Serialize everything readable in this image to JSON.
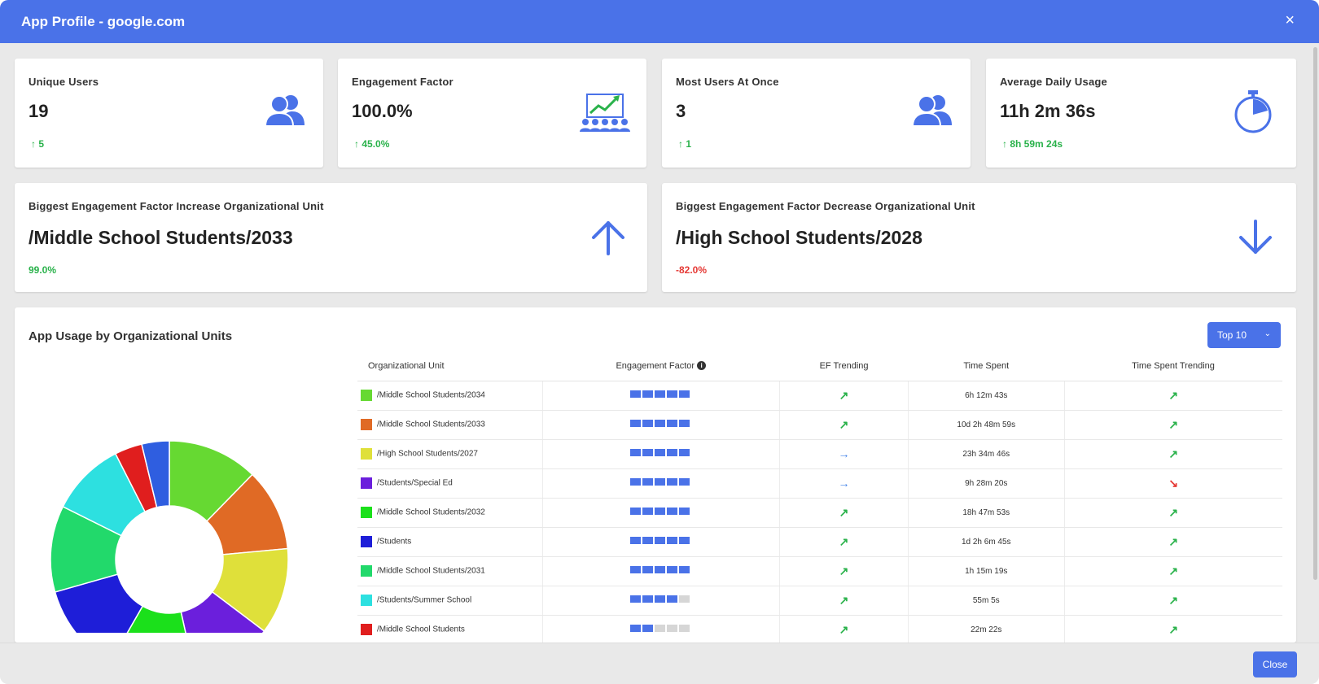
{
  "window": {
    "title": "App Profile - google.com",
    "close_glyph": "×"
  },
  "stats": [
    {
      "label": "Unique Users",
      "value": "19",
      "delta": "5",
      "icon": "users-icon"
    },
    {
      "label": "Engagement Factor",
      "value": "100.0%",
      "delta": "45.0%",
      "icon": "presentation-chart-icon"
    },
    {
      "label": "Most Users At Once",
      "value": "3",
      "delta": "1",
      "icon": "users-icon"
    },
    {
      "label": "Average Daily Usage",
      "value": "11h 2m 36s",
      "delta": "8h 59m 24s",
      "icon": "stopwatch-icon"
    }
  ],
  "delta_arrow": "↑",
  "increase": {
    "label": "Biggest Engagement Factor Increase Organizational Unit",
    "value": "/Middle School Students/2033",
    "delta": "99.0%",
    "icon": "arrow-up-icon"
  },
  "decrease": {
    "label": "Biggest Engagement Factor Decrease Organizational Unit",
    "value": "/High School Students/2028",
    "delta": "-82.0%",
    "icon": "arrow-down-icon"
  },
  "usage": {
    "title": "App Usage by Organizational Units",
    "top_select": "Top 10",
    "columns": [
      "Organizational Unit",
      "Engagement Factor",
      "EF Trending",
      "Time Spent",
      "Time Spent Trending"
    ],
    "rows": [
      {
        "unit": "/Middle School Students/2034",
        "color": "#66d932",
        "ef": 5,
        "ef_trend": "up",
        "time": "6h 12m 43s",
        "time_trend": "up"
      },
      {
        "unit": "/Middle School Students/2033",
        "color": "#e06a25",
        "ef": 5,
        "ef_trend": "up",
        "time": "10d 2h 48m 59s",
        "time_trend": "up"
      },
      {
        "unit": "/High School Students/2027",
        "color": "#dfe03a",
        "ef": 5,
        "ef_trend": "right",
        "time": "23h 34m 46s",
        "time_trend": "up"
      },
      {
        "unit": "/Students/Special Ed",
        "color": "#6b1fdc",
        "ef": 5,
        "ef_trend": "right",
        "time": "9h 28m 20s",
        "time_trend": "down"
      },
      {
        "unit": "/Middle School Students/2032",
        "color": "#1be01b",
        "ef": 5,
        "ef_trend": "up",
        "time": "18h 47m 53s",
        "time_trend": "up"
      },
      {
        "unit": "/Students",
        "color": "#1e1ed8",
        "ef": 5,
        "ef_trend": "up",
        "time": "1d 2h 6m 45s",
        "time_trend": "up"
      },
      {
        "unit": "/Middle School Students/2031",
        "color": "#22d96b",
        "ef": 5,
        "ef_trend": "up",
        "time": "1h 15m 19s",
        "time_trend": "up"
      },
      {
        "unit": "/Students/Summer School",
        "color": "#2de0e0",
        "ef": 4,
        "ef_trend": "up",
        "time": "55m 5s",
        "time_trend": "up"
      },
      {
        "unit": "/Middle School Students",
        "color": "#e01e1e",
        "ef": 2,
        "ef_trend": "up",
        "time": "22m 22s",
        "time_trend": "up"
      }
    ],
    "trend_glyphs": {
      "up": "↗",
      "right": "→",
      "down": "↘"
    }
  },
  "chart_data": {
    "type": "pie",
    "donut": true,
    "slices": [
      {
        "label": "/Middle School Students/2034",
        "color": "#66d932",
        "value": 11.5
      },
      {
        "label": "/Middle School Students/2033",
        "color": "#e06a25",
        "value": 10.5
      },
      {
        "label": "/High School Students/2027",
        "color": "#dfe03a",
        "value": 11.0
      },
      {
        "label": "/Students/Special Ed",
        "color": "#6b1fdc",
        "value": 10.5
      },
      {
        "label": "/Middle School Students/2032",
        "color": "#1be01b",
        "value": 11.0
      },
      {
        "label": "/Students",
        "color": "#1e1ed8",
        "value": 11.5
      },
      {
        "label": "/Middle School Students/2031",
        "color": "#22d96b",
        "value": 11.0
      },
      {
        "label": "/Students/Summer School",
        "color": "#2de0e0",
        "value": 9.5
      },
      {
        "label": "/Middle School Students",
        "color": "#e01e1e",
        "value": 3.5
      },
      {
        "label": "",
        "color": "#2f5ee0",
        "value": 3.5
      }
    ]
  },
  "footer": {
    "close_label": "Close"
  }
}
